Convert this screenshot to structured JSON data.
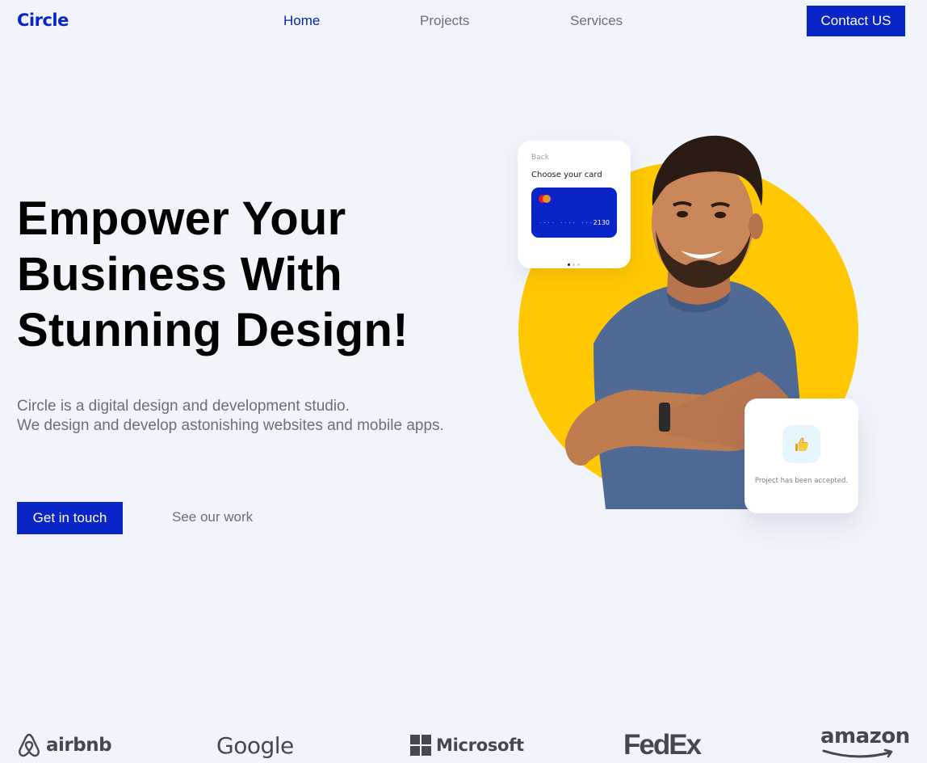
{
  "header": {
    "logo": "Circle",
    "nav": [
      {
        "label": "Home",
        "active": true
      },
      {
        "label": "Projects",
        "active": false
      },
      {
        "label": "Services",
        "active": false
      }
    ],
    "contact_label": "Contact US"
  },
  "hero": {
    "title_lines": [
      "Empower Your",
      "Business With",
      "Stunning Design!"
    ],
    "description_lines": [
      "Circle is a digital design and development studio.",
      "We design and develop astonishing websites and mobile apps."
    ],
    "primary_cta": "Get in touch",
    "secondary_cta": "See our work"
  },
  "card_widget": {
    "back_label": "Back",
    "title": "Choose your card",
    "card_mask": "····  ····  ····",
    "card_last_digits": "2130"
  },
  "accept_widget": {
    "icon": "thumbs-up-icon",
    "message": "Project has been accepted."
  },
  "brands": [
    "airbnb",
    "Google",
    "Microsoft",
    "FedEx",
    "amazon"
  ],
  "colors": {
    "brand_blue": "#0a25c7",
    "accent_yellow": "#ffc800",
    "background": "#f1f4fb",
    "muted_text": "#6b6f7c"
  }
}
